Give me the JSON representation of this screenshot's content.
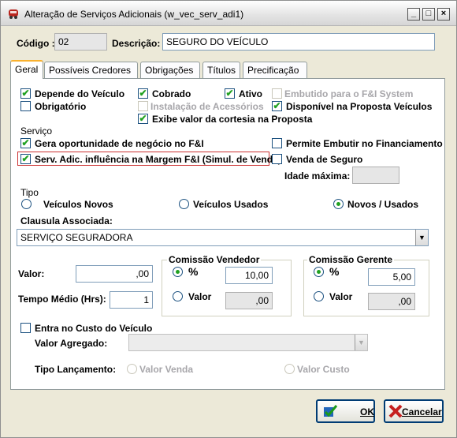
{
  "window": {
    "title": "Alteração de Serviços Adicionais (w_vec_serv_adi1)",
    "minimize": "_",
    "maximize": "□",
    "close": "×"
  },
  "header": {
    "codigo_label": "Código :",
    "codigo_value": "02",
    "descricao_label": "Descrição:",
    "descricao_value": "SEGURO DO VEÍCULO"
  },
  "tabs": [
    {
      "label": "Geral",
      "active": true
    },
    {
      "label": "Possíveis Credores"
    },
    {
      "label": "Obrigações"
    },
    {
      "label": "Títulos"
    },
    {
      "label": "Precificação"
    }
  ],
  "general": {
    "depende_veiculo": {
      "label": "Depende do Veículo",
      "checked": true
    },
    "cobrado": {
      "label": "Cobrado",
      "checked": true
    },
    "ativo": {
      "label": "Ativo",
      "checked": true
    },
    "embutido": {
      "label": "Embutido para o F&I System",
      "checked": false,
      "disabled": true
    },
    "obrigatorio": {
      "label": "Obrigatório",
      "checked": false
    },
    "instalacao": {
      "label": "Instalação de Acessórios",
      "checked": false,
      "disabled": true
    },
    "disponivel": {
      "label": "Disponível na Proposta Veículos",
      "checked": true
    },
    "exibe_valor": {
      "label": "Exibe valor da cortesia na Proposta",
      "checked": true
    }
  },
  "servico": {
    "section_label": "Serviço",
    "gera_oportunidade": {
      "label": "Gera oportunidade de negócio no F&I",
      "checked": true
    },
    "permite_embutir": {
      "label": "Permite Embutir no Financiamento",
      "checked": false
    },
    "serv_adic": {
      "label": "Serv. Adic. influência na Margem F&I (Simul. de Venda)",
      "checked": true
    },
    "venda_seguro": {
      "label": "Venda de Seguro",
      "checked": false
    },
    "idade_maxima_label": "Idade máxima:",
    "idade_maxima_value": ""
  },
  "tipo": {
    "section_label": "Tipo",
    "options": [
      "Veículos Novos",
      "Veículos Usados",
      "Novos / Usados"
    ],
    "selected": "Novos / Usados"
  },
  "clausula": {
    "label": "Clausula Associada:",
    "value": "SERVIÇO SEGURADORA"
  },
  "valores": {
    "valor_label": "Valor:",
    "valor_value": ",00",
    "tempo_label": "Tempo Médio (Hrs):",
    "tempo_value": "1",
    "comissao_vendedor": {
      "title": "Comissão Vendedor",
      "pct_label": "%",
      "pct_value": "10,00",
      "valor_label": "Valor",
      "valor_value": ",00",
      "selected": "%"
    },
    "comissao_gerente": {
      "title": "Comissão Gerente",
      "pct_label": "%",
      "pct_value": "5,00",
      "valor_label": "Valor",
      "valor_value": ",00",
      "selected": "%"
    }
  },
  "custo": {
    "entra_label": "Entra no Custo do Veículo",
    "entra_checked": false,
    "agregado_label": "Valor Agregado:",
    "tipo_lanc_label": "Tipo Lançamento:",
    "valor_venda": "Valor Venda",
    "valor_custo": "Valor Custo"
  },
  "buttons": {
    "ok": "OK",
    "cancelar": "Cancelar"
  },
  "colors": {
    "check_green": "#21a121",
    "tab_accent": "#f9b12e",
    "highlight_red": "#cc3333"
  }
}
